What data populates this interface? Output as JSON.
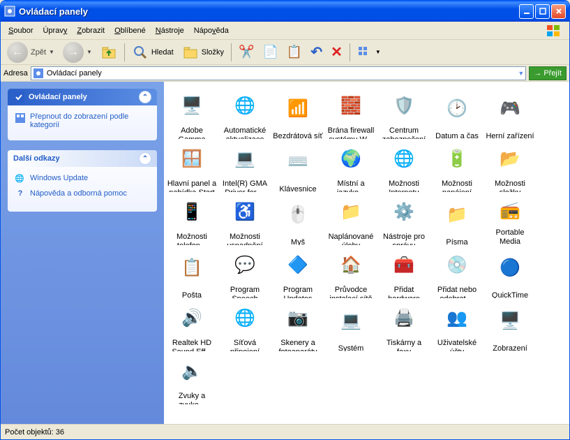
{
  "window": {
    "title": "Ovládací panely"
  },
  "menu": {
    "file": "Soubor",
    "edit": "Úpravy",
    "view": "Zobrazit",
    "fav": "Oblíbené",
    "tools": "Nástroje",
    "help": "Nápověda"
  },
  "toolbar": {
    "back": "Zpět",
    "search": "Hledat",
    "folders": "Složky"
  },
  "address": {
    "label": "Adresa",
    "value": "Ovládací panely",
    "go": "Přejít"
  },
  "sidebar": {
    "panel1": {
      "title": "Ovládací panely",
      "link": "Přepnout do zobrazení podle kategorií"
    },
    "panel2": {
      "title": "Další odkazy",
      "links": [
        "Windows Update",
        "Nápověda a odborná pomoc"
      ]
    }
  },
  "items": [
    {
      "label": "Adobe Gamma",
      "icon": "🖥️"
    },
    {
      "label": "Automatické aktualizace",
      "icon": "🌐"
    },
    {
      "label": "Bezdrátová síť",
      "icon": "📶"
    },
    {
      "label": "Brána firewall systému W...",
      "icon": "🧱"
    },
    {
      "label": "Centrum zabezpečení",
      "icon": "🛡️"
    },
    {
      "label": "Datum a čas",
      "icon": "🕑"
    },
    {
      "label": "Herní zařízení",
      "icon": "🎮"
    },
    {
      "label": "Hlavní panel a nabídka Start",
      "icon": "🪟"
    },
    {
      "label": "Intel(R) GMA Driver for ...",
      "icon": "💻"
    },
    {
      "label": "Klávesnice",
      "icon": "⌨️"
    },
    {
      "label": "Místní a jazyko...",
      "icon": "🌍"
    },
    {
      "label": "Možnosti Internetu",
      "icon": "🌐"
    },
    {
      "label": "Možnosti napájení",
      "icon": "🔋"
    },
    {
      "label": "Možnosti složky",
      "icon": "📂"
    },
    {
      "label": "Možnosti telefon...",
      "icon": "📱"
    },
    {
      "label": "Možnosti usnadnění",
      "icon": "♿"
    },
    {
      "label": "Myš",
      "icon": "🖱️"
    },
    {
      "label": "Naplánované úlohy",
      "icon": "📁"
    },
    {
      "label": "Nástroje pro správu",
      "icon": "⚙️"
    },
    {
      "label": "Písma",
      "icon": "📁"
    },
    {
      "label": "Portable Media Devices",
      "icon": "📻"
    },
    {
      "label": "Pošta",
      "icon": "📋"
    },
    {
      "label": "Program Speech",
      "icon": "💬"
    },
    {
      "label": "Program Updates",
      "icon": "🔷"
    },
    {
      "label": "Průvodce instalací sítě",
      "icon": "🏠"
    },
    {
      "label": "Přidat hardware",
      "icon": "🧰"
    },
    {
      "label": "Přidat nebo odebrat ...",
      "icon": "💿"
    },
    {
      "label": "QuickTime",
      "icon": "🔵"
    },
    {
      "label": "Realtek HD Sound Eff...",
      "icon": "🔊"
    },
    {
      "label": "Síťová připojení",
      "icon": "🌐"
    },
    {
      "label": "Skenery a fotoaparáty",
      "icon": "📷"
    },
    {
      "label": "Systém",
      "icon": "💻"
    },
    {
      "label": "Tiskárny a faxy",
      "icon": "🖨️"
    },
    {
      "label": "Uživatelské účty",
      "icon": "👥"
    },
    {
      "label": "Zobrazení",
      "icon": "🖥️"
    },
    {
      "label": "Zvuky a zvuko...",
      "icon": "🔈"
    }
  ],
  "status": {
    "count_label": "Počet objektů: 36"
  }
}
